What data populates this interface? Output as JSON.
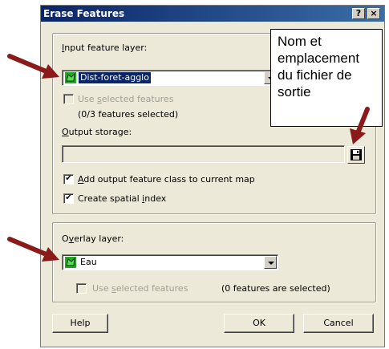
{
  "dialog": {
    "title": "Erase Features",
    "help_glyph": "?",
    "close_glyph": "×"
  },
  "input_group": {
    "label_prefix": "",
    "label_underlined": "I",
    "label_rest": "nput feature layer:",
    "layer_value": "Dist-foret-agglo",
    "use_selected_pre": "Use ",
    "use_selected_u": "s",
    "use_selected_post": "elected features",
    "selected_count": "(0/3 features selected)",
    "output_label_u": "O",
    "output_label_rest": "utput storage:",
    "output_value": "",
    "add_output_pre": "",
    "add_output_u": "A",
    "add_output_post": "dd output feature class to current map",
    "spatial_index_pre": "Create spatial ",
    "spatial_index_u": "i",
    "spatial_index_post": "ndex"
  },
  "overlay_group": {
    "label_pre": "O",
    "label_u": "v",
    "label_post": "erlay layer:",
    "layer_value": "Eau",
    "use_selected_pre": "Use ",
    "use_selected_u": "s",
    "use_selected_post": "elected features",
    "selected_count": "(0 features are selected)"
  },
  "buttons": {
    "help": "Help",
    "ok": "OK",
    "cancel": "Cancel"
  },
  "callout": {
    "line1": "Nom et",
    "line2": "emplacement",
    "line3": "du fichier de",
    "line4": "sortie"
  },
  "checkbox_states": {
    "input_use_selected": false,
    "add_output": true,
    "spatial_index": true,
    "overlay_use_selected": false
  },
  "colors": {
    "arrow": "#8b1a1a",
    "titlebar": "#0a246a",
    "dialog_bg": "#ece9d8",
    "layer_icon": "#22aa22"
  },
  "icons": {
    "layer": "polygon-layer-icon",
    "save": "floppy-disk-icon",
    "arrow": "arrow-icon"
  }
}
